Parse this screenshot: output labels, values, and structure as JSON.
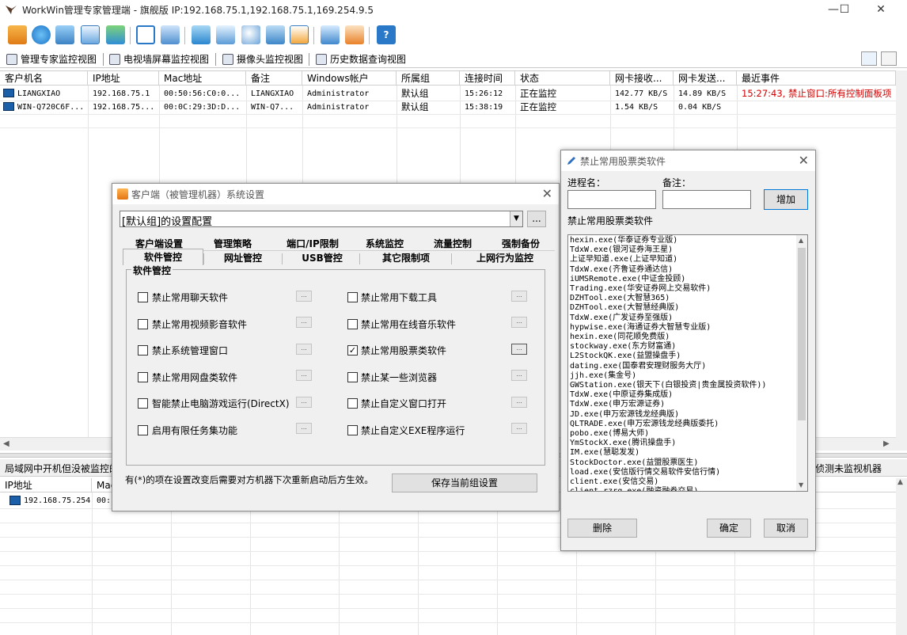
{
  "window": {
    "title": "WorkWin管理专家管理端 - 旗舰版 IP:192.168.75.1,192.168.75.1,169.254.9.5",
    "min": "—",
    "max": "☐",
    "close": "✕"
  },
  "toolbar_icons": [
    "monitor-icon",
    "globe-icon",
    "settings-icon",
    "report-icon",
    "users-icon",
    "grid-icon",
    "lock-icon",
    "screen-icon",
    "cast-icon",
    "search-icon",
    "network-icon",
    "chart-icon",
    "info-icon",
    "alert-icon",
    "help-icon"
  ],
  "view_tabs": [
    "管理专家监控视图",
    "电视墙屏幕监控视图",
    "摄像头监控视图",
    "历史数据查询视图"
  ],
  "main_table": {
    "headers": [
      "客户机名",
      "IP地址",
      "Mac地址",
      "备注",
      "Windows帐户",
      "所属组",
      "连接时间",
      "状态",
      "网卡接收...",
      "网卡发送...",
      "最近事件"
    ],
    "rows": [
      [
        "LIANGXIAO",
        "192.168.75.1",
        "00:50:56:C0:0...",
        "LIANGXIAO",
        "Administrator",
        "默认组",
        "15:26:12",
        "正在监控",
        "142.77 KB/S",
        "14.89 KB/S",
        "15:27:43, 禁止窗口:所有控制面板项"
      ],
      [
        "WIN-Q720C6F...",
        "192.168.75...",
        "00:0C:29:3D:D...",
        "WIN-Q7...",
        "Administrator",
        "默认组",
        "15:38:19",
        "正在监控",
        "1.54 KB/S",
        "0.04 KB/S",
        ""
      ]
    ]
  },
  "lower_panel": {
    "title": "局域网中开机但没被监控的",
    "right_text": "侦测未监视机器",
    "headers": [
      "IP地址",
      "Mac"
    ],
    "rows": [
      [
        "192.168.75.254",
        "00:"
      ]
    ]
  },
  "settings_dialog": {
    "title": "客户端（被管理机器）系统设置",
    "config_select": "[默认组]的设置配置",
    "more_btn": "...",
    "tabs_row1": [
      "客户端设置",
      "管理策略",
      "端口/IP限制",
      "系统监控",
      "流量控制",
      "强制备份"
    ],
    "tabs_row2": [
      "软件管控",
      "网址管控",
      "USB管控",
      "其它限制项",
      "上网行为监控"
    ],
    "group_title": "软件管控",
    "options_left": [
      {
        "label": "禁止常用聊天软件",
        "checked": false
      },
      {
        "label": "禁止常用视频影音软件",
        "checked": false
      },
      {
        "label": "禁止系统管理窗口",
        "checked": false
      },
      {
        "label": "禁止常用网盘类软件",
        "checked": false
      },
      {
        "label": "智能禁止电脑游戏运行(DirectX)",
        "checked": false
      },
      {
        "label": "启用有限任务集功能",
        "checked": false
      }
    ],
    "options_right": [
      {
        "label": "禁止常用下载工具",
        "checked": false
      },
      {
        "label": "禁止常用在线音乐软件",
        "checked": false
      },
      {
        "label": "禁止常用股票类软件",
        "checked": true
      },
      {
        "label": "禁止某一些浏览器",
        "checked": false
      },
      {
        "label": "禁止自定义窗口打开",
        "checked": false
      },
      {
        "label": "禁止自定义EXE程序运行",
        "checked": false
      }
    ],
    "note": "有(*)的项在设置改变后需要对方机器下次重新启动后方生效。",
    "save_btn": "保存当前组设置",
    "tiny_btn": "..."
  },
  "stock_dialog": {
    "title": "禁止常用股票类软件",
    "process_label": "进程名：",
    "remark_label": "备注：",
    "process_value": "",
    "remark_value": "",
    "add_btn": "增加",
    "list_label": "禁止常用股票类软件",
    "items": [
      "hexin.exe(华泰证券专业版)",
      "TdxW.exe(银河证券海王星)",
      "上证早知道.exe(上证早知道)",
      "TdxW.exe(齐鲁证券通达信)",
      "iUMSRemote.exe(中证金投顾)",
      "Trading.exe(华安证券网上交易软件)",
      "DZHTool.exe(大智慧365)",
      "DZHTool.exe(大智慧经典版)",
      "TdxW.exe(广发证券至强版)",
      "hypwise.exe(海通证券大智慧专业版)",
      "hexin.exe(同花顺免费版)",
      "stockway.exe(东方财富通)",
      "L2StockQK.exe(益盟操盘手)",
      "dating.exe(国泰君安理财服务大厅)",
      "jjh.exe(集金号)",
      "GWStation.exe(银天下(白银投资|贵金属投资软件))",
      "TdxW.exe(中原证券集成版)",
      "TdxW.exe(申万宏源证券)",
      "JD.exe(申万宏源钱龙经典版)",
      "QLTRADE.exe(申万宏源钱龙经典版委托)",
      "pobo.exe(博易大师)",
      "YmStockX.exe(腾讯操盘手)",
      "IM.exe(慧聪发发)",
      "StockDoctor.exe(益盟股票医生)",
      "load.exe(安信版行情交易软件安信行情)",
      "client.exe(安信交易)",
      "client_rzrq.exe(融资融券交易)"
    ],
    "delete_btn": "删除",
    "ok_btn": "确定",
    "cancel_btn": "取消"
  }
}
